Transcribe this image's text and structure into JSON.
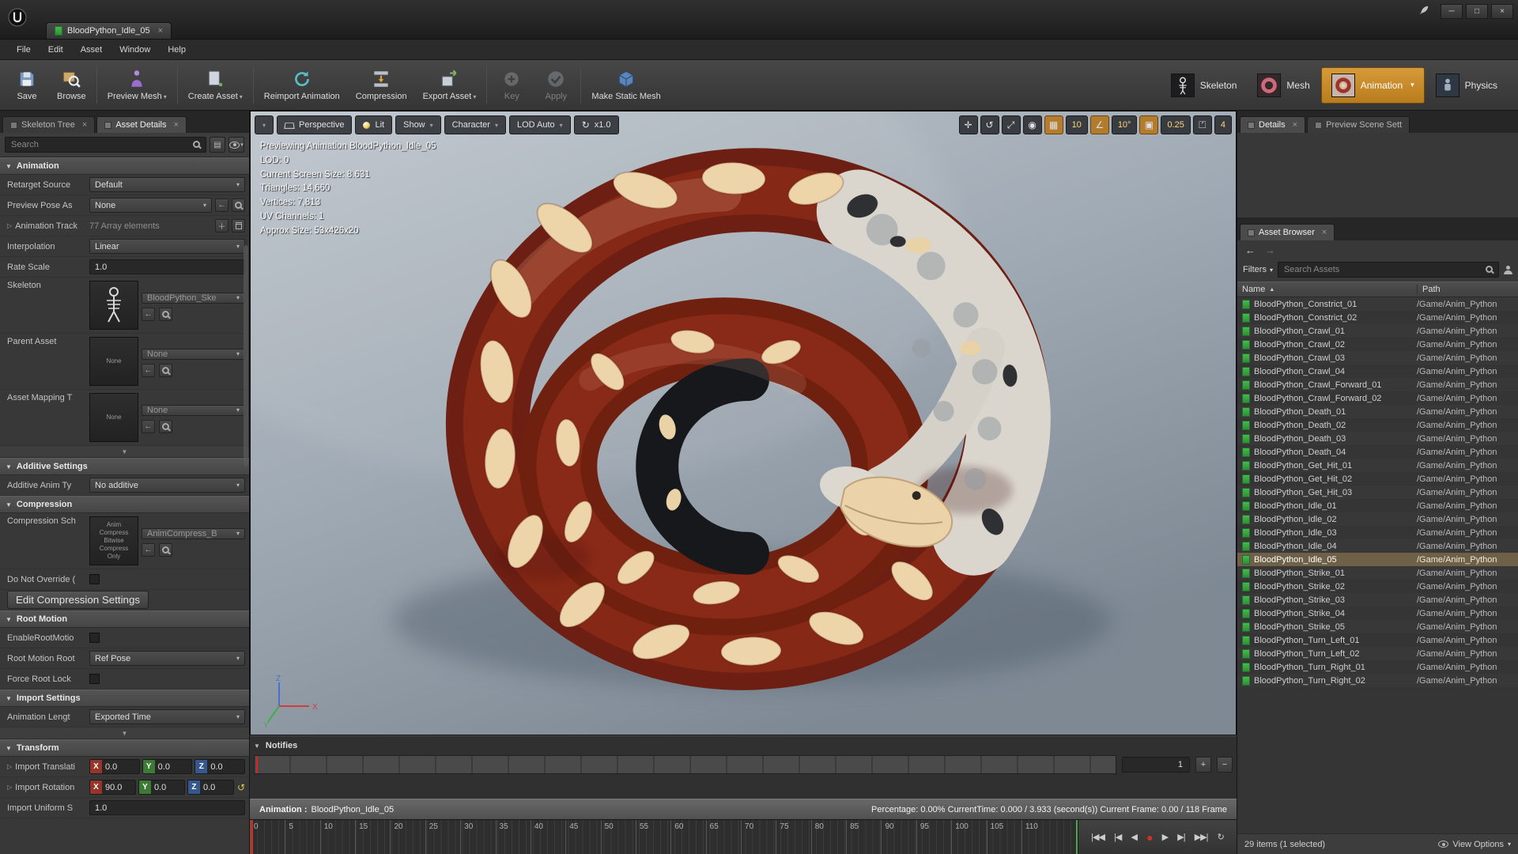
{
  "colors": {
    "accent_orange": "#c98b2c",
    "selection_row": "#6e6148",
    "snake_red": "#7c2518",
    "asset_icon_green": "#3fae46",
    "record_red": "#d03326"
  },
  "window": {
    "tab_title": "BloodPython_Idle_05",
    "controls": {
      "minimize": "─",
      "maximize": "□",
      "close": "×"
    }
  },
  "menu": {
    "items": [
      "File",
      "Edit",
      "Asset",
      "Window",
      "Help"
    ]
  },
  "toolbar": {
    "save": "Save",
    "browse": "Browse",
    "preview_mesh": "Preview Mesh",
    "create_asset": "Create Asset",
    "reimport": "Reimport Animation",
    "compression": "Compression",
    "export_asset": "Export Asset",
    "key": "Key",
    "apply": "Apply",
    "make_static_mesh": "Make Static Mesh",
    "modes": {
      "skeleton": "Skeleton",
      "mesh": "Mesh",
      "animation": "Animation",
      "physics": "Physics"
    }
  },
  "asset_details": {
    "tabs": {
      "skeleton_tree": "Skeleton Tree",
      "asset_details": "Asset Details"
    },
    "search_placeholder": "Search",
    "animation_section": {
      "title": "Animation",
      "retarget_source": {
        "label": "Retarget Source",
        "value": "Default"
      },
      "preview_pose": {
        "label": "Preview Pose As",
        "value": "None"
      },
      "animation_track": {
        "label": "Animation Track",
        "value": "77 Array elements"
      },
      "interpolation": {
        "label": "Interpolation",
        "value": "Linear"
      },
      "rate_scale": {
        "label": "Rate Scale",
        "value": "1.0"
      },
      "skeleton": {
        "label": "Skeleton",
        "value": "BloodPython_Ske"
      },
      "parent_asset": {
        "label": "Parent Asset",
        "value": "None",
        "thumb": "None"
      },
      "asset_mapping": {
        "label": "Asset Mapping T",
        "value": "None",
        "thumb": "None"
      }
    },
    "additive_section": {
      "title": "Additive Settings",
      "additive_anim": {
        "label": "Additive Anim Ty",
        "value": "No additive"
      }
    },
    "compression_section": {
      "title": "Compression",
      "scheme": {
        "label": "Compression Sch",
        "value": "AnimCompress_B",
        "thumb": "Anim Compress Bitwise Compress Only"
      },
      "do_not_override": {
        "label": "Do Not Override ("
      },
      "edit_button": "Edit Compression Settings"
    },
    "root_motion_section": {
      "title": "Root Motion",
      "enable": {
        "label": "EnableRootMotio"
      },
      "root": {
        "label": "Root Motion Root",
        "value": "Ref Pose"
      },
      "force_lock": {
        "label": "Force Root Lock"
      }
    },
    "import_section": {
      "title": "Import Settings",
      "anim_length": {
        "label": "Animation Lengt",
        "value": "Exported Time"
      }
    },
    "transform_section": {
      "title": "Transform",
      "translation": {
        "label": "Import Translati",
        "x": "0.0",
        "y": "0.0",
        "z": "0.0"
      },
      "rotation": {
        "label": "Import Rotation",
        "x": "90.0",
        "y": "0.0",
        "z": "0.0"
      },
      "uniform": {
        "label": "Import Uniform S",
        "value": "1.0"
      }
    }
  },
  "viewport": {
    "toolbar": {
      "perspective": "Perspective",
      "lit": "Lit",
      "show": "Show",
      "character": "Character",
      "lod_auto": "LOD Auto",
      "speed": "x1.0"
    },
    "snaps": {
      "grid": "10",
      "rotation": "10°",
      "scale": "0.25",
      "camera_speed": "4"
    },
    "stats": [
      "Previewing Animation BloodPython_Idle_05",
      "LOD: 0",
      "Current Screen Size: 8.631",
      "Triangles: 14,660",
      "Vertices: 7,813",
      "UV Channels: 1",
      "Approx Size: 53x426x20"
    ],
    "axes": {
      "x": "X",
      "y": "Y",
      "z": "Z"
    }
  },
  "timeline": {
    "notifies": {
      "title": "Notifies",
      "track_count": "1",
      "add": "+",
      "remove": "−"
    },
    "anim_bar": {
      "label": "Animation :",
      "name": "BloodPython_Idle_05",
      "status": "Percentage:  0.00% CurrentTime:  0.000 / 3.933 (second(s)) Current Frame:  0.00 / 118 Frame"
    },
    "ruler_labels": [
      "0",
      "5",
      "10",
      "15",
      "20",
      "25",
      "30",
      "35",
      "40",
      "45",
      "50",
      "55",
      "60",
      "65",
      "70",
      "75",
      "80",
      "85",
      "90",
      "95",
      "100",
      "105",
      "110"
    ],
    "transport": [
      "|◀◀",
      "|◀",
      "◀",
      "●",
      "▶",
      "▶|",
      "▶▶|",
      "↻"
    ]
  },
  "right_panel": {
    "tabs": {
      "details": "Details",
      "preview_scene": "Preview Scene Sett"
    },
    "asset_browser": {
      "tab": "Asset Browser",
      "filters": "Filters",
      "search_placeholder": "Search Assets",
      "columns": {
        "name": "Name",
        "path": "Path"
      },
      "assets": [
        {
          "name": "BloodPython_Constrict_01",
          "path": "/Game/Anim_Python"
        },
        {
          "name": "BloodPython_Constrict_02",
          "path": "/Game/Anim_Python"
        },
        {
          "name": "BloodPython_Crawl_01",
          "path": "/Game/Anim_Python"
        },
        {
          "name": "BloodPython_Crawl_02",
          "path": "/Game/Anim_Python"
        },
        {
          "name": "BloodPython_Crawl_03",
          "path": "/Game/Anim_Python"
        },
        {
          "name": "BloodPython_Crawl_04",
          "path": "/Game/Anim_Python"
        },
        {
          "name": "BloodPython_Crawl_Forward_01",
          "path": "/Game/Anim_Python"
        },
        {
          "name": "BloodPython_Crawl_Forward_02",
          "path": "/Game/Anim_Python"
        },
        {
          "name": "BloodPython_Death_01",
          "path": "/Game/Anim_Python"
        },
        {
          "name": "BloodPython_Death_02",
          "path": "/Game/Anim_Python"
        },
        {
          "name": "BloodPython_Death_03",
          "path": "/Game/Anim_Python"
        },
        {
          "name": "BloodPython_Death_04",
          "path": "/Game/Anim_Python"
        },
        {
          "name": "BloodPython_Get_Hit_01",
          "path": "/Game/Anim_Python"
        },
        {
          "name": "BloodPython_Get_Hit_02",
          "path": "/Game/Anim_Python"
        },
        {
          "name": "BloodPython_Get_Hit_03",
          "path": "/Game/Anim_Python"
        },
        {
          "name": "BloodPython_Idle_01",
          "path": "/Game/Anim_Python"
        },
        {
          "name": "BloodPython_Idle_02",
          "path": "/Game/Anim_Python"
        },
        {
          "name": "BloodPython_Idle_03",
          "path": "/Game/Anim_Python"
        },
        {
          "name": "BloodPython_Idle_04",
          "path": "/Game/Anim_Python"
        },
        {
          "name": "BloodPython_Idle_05",
          "path": "/Game/Anim_Python",
          "selected": true
        },
        {
          "name": "BloodPython_Strike_01",
          "path": "/Game/Anim_Python"
        },
        {
          "name": "BloodPython_Strike_02",
          "path": "/Game/Anim_Python"
        },
        {
          "name": "BloodPython_Strike_03",
          "path": "/Game/Anim_Python"
        },
        {
          "name": "BloodPython_Strike_04",
          "path": "/Game/Anim_Python"
        },
        {
          "name": "BloodPython_Strike_05",
          "path": "/Game/Anim_Python"
        },
        {
          "name": "BloodPython_Turn_Left_01",
          "path": "/Game/Anim_Python"
        },
        {
          "name": "BloodPython_Turn_Left_02",
          "path": "/Game/Anim_Python"
        },
        {
          "name": "BloodPython_Turn_Right_01",
          "path": "/Game/Anim_Python"
        },
        {
          "name": "BloodPython_Turn_Right_02",
          "path": "/Game/Anim_Python"
        }
      ],
      "status": "29 items (1 selected)",
      "view_options": "View Options"
    }
  }
}
